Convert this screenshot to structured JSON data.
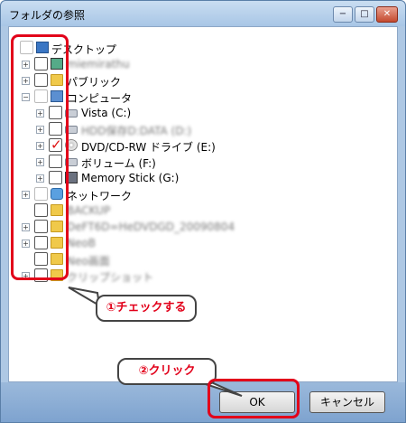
{
  "window": {
    "title": "フォルダの参照",
    "min_label": "−",
    "max_label": "□",
    "close_label": "✕"
  },
  "tree": {
    "desktop": "デスクトップ",
    "user": "miemirathu",
    "public": "パブリック",
    "computer": "コンピュータ",
    "vista": "Vista (C:)",
    "drive_d": "HDD保存D:DATA (D:)",
    "dvd": "DVD/CD-RW ドライブ (E:)",
    "volume_f": "ボリューム (F:)",
    "memory_stick": "Memory Stick (G:)",
    "network": "ネットワーク",
    "folder1": "BACKUP",
    "folder2": "DeFT6D=HeDVDGD_20090804",
    "folder3": "NeoB",
    "folder4": "Neo画面",
    "folder5": "クリップショット"
  },
  "callouts": {
    "check": "①チェックする",
    "click": "②クリック"
  },
  "buttons": {
    "ok": "OK",
    "cancel": "キャンセル"
  }
}
